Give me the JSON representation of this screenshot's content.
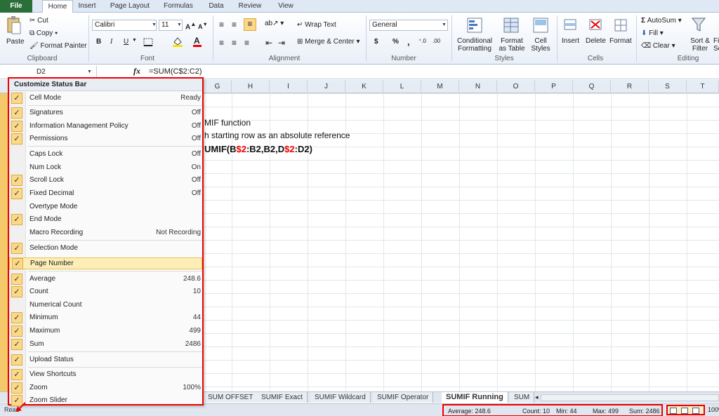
{
  "tabs": [
    "File",
    "Home",
    "Insert",
    "Page Layout",
    "Formulas",
    "Data",
    "Review",
    "View"
  ],
  "clipboard": {
    "paste": "Paste",
    "cut": "Cut",
    "copy": "Copy",
    "format_painter": "Format Painter",
    "group": "Clipboard"
  },
  "font": {
    "name": "Calibri",
    "size": "11",
    "group": "Font",
    "bold": "B",
    "italic": "I",
    "underline": "U"
  },
  "alignment": {
    "wrap_text": "Wrap Text",
    "merge_center": "Merge & Center",
    "group": "Alignment"
  },
  "number": {
    "format": "General",
    "currency": "$",
    "percent": "%",
    "comma": ",",
    "group": "Number"
  },
  "styles": {
    "conditional": "Conditional\nFormatting",
    "format_table": "Format\nas Table",
    "cell_styles": "Cell\nStyles",
    "group": "Styles"
  },
  "cells": {
    "insert": "Insert",
    "delete": "Delete",
    "format": "Format",
    "group": "Cells"
  },
  "editing": {
    "autosum": "AutoSum",
    "fill": "Fill",
    "clear": "Clear",
    "sort_filter": "Sort &\nFilter",
    "find_select": "Fi\nSe",
    "group": "Editing"
  },
  "formula_bar": {
    "cell_ref": "D2",
    "fx": "fx",
    "formula": "=SUM(C$2:C2)"
  },
  "columns": [
    "G",
    "H",
    "I",
    "J",
    "K",
    "L",
    "M",
    "N",
    "O",
    "P",
    "Q",
    "R",
    "S",
    "T"
  ],
  "cells_text": {
    "line1": "MIF function",
    "line2": "h starting row as an absolute reference",
    "formula_parts": [
      "UMIF(B",
      "$2",
      ":B2,B2,D",
      "$2",
      ":D2)"
    ]
  },
  "menu": {
    "title": "Customize Status Bar",
    "items": [
      {
        "label": "Cell Mode",
        "value": "Ready",
        "checked": true
      },
      {
        "label": "Signatures",
        "value": "Off",
        "checked": true
      },
      {
        "label": "Information Management Policy",
        "value": "Off",
        "checked": true
      },
      {
        "label": "Permissions",
        "value": "Off",
        "checked": true
      },
      {
        "label": "Caps Lock",
        "value": "Off",
        "checked": false
      },
      {
        "label": "Num Lock",
        "value": "On",
        "checked": false
      },
      {
        "label": "Scroll Lock",
        "value": "Off",
        "checked": true
      },
      {
        "label": "Fixed Decimal",
        "value": "Off",
        "checked": true
      },
      {
        "label": "Overtype Mode",
        "value": "",
        "checked": false
      },
      {
        "label": "End Mode",
        "value": "",
        "checked": true
      },
      {
        "label": "Macro Recording",
        "value": "Not Recording",
        "checked": false
      },
      {
        "label": "Selection Mode",
        "value": "",
        "checked": true
      },
      {
        "label": "Page Number",
        "value": "",
        "checked": true
      },
      {
        "label": "Average",
        "value": "248.6",
        "checked": true
      },
      {
        "label": "Count",
        "value": "10",
        "checked": true
      },
      {
        "label": "Numerical Count",
        "value": "",
        "checked": false
      },
      {
        "label": "Minimum",
        "value": "44",
        "checked": true
      },
      {
        "label": "Maximum",
        "value": "499",
        "checked": true
      },
      {
        "label": "Sum",
        "value": "2486",
        "checked": true
      },
      {
        "label": "Upload Status",
        "value": "",
        "checked": true
      },
      {
        "label": "View Shortcuts",
        "value": "",
        "checked": true
      },
      {
        "label": "Zoom",
        "value": "100%",
        "checked": true
      },
      {
        "label": "Zoom Slider",
        "value": "",
        "checked": true
      }
    ]
  },
  "sheet_tabs": [
    "SUM OFFSET",
    "SUMIF Exact",
    "SUMIF Wildcard",
    "SUMIF Operator",
    "SUMIF Running",
    "SUM"
  ],
  "active_sheet": "SUMIF Running",
  "status": {
    "ready": "Read",
    "average": "Average: 248.6",
    "count": "Count: 10",
    "min": "Min: 44",
    "max": "Max: 499",
    "sum": "Sum: 2486",
    "zoom": "100%"
  },
  "colors": {
    "highlight": "#e00000",
    "ribbon_tab": "#2a6f3a",
    "check": "#fcd989"
  }
}
